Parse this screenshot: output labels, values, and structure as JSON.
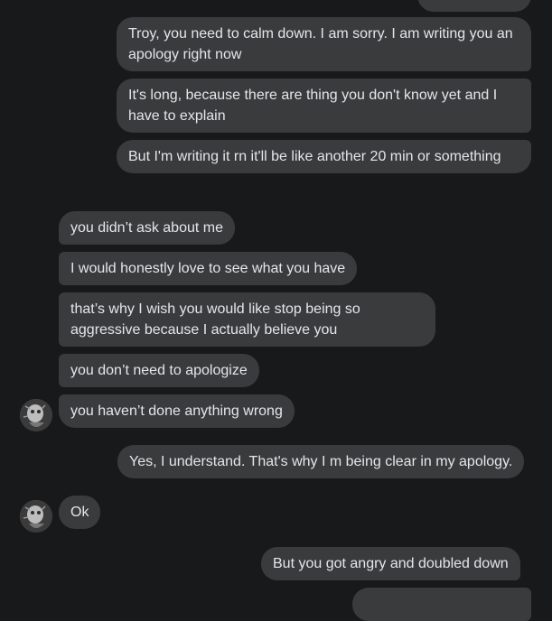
{
  "conversation": {
    "messages": [
      {
        "sender": "me",
        "text": "Troy, you need to calm down. I am sorry. I am writing you an apology right now"
      },
      {
        "sender": "me",
        "text": "It's long, because there are thing you don't know yet and I have to explain"
      },
      {
        "sender": "me",
        "text": "But I'm writing it rn it'll be like another 20 min or something"
      },
      {
        "sender": "them",
        "text": "you didn’t ask about me"
      },
      {
        "sender": "them",
        "text": "I would honestly love to see what you have"
      },
      {
        "sender": "them",
        "text": "that’s why I wish you would like stop being so aggressive because I actually believe you"
      },
      {
        "sender": "them",
        "text": "you don’t need to apologize"
      },
      {
        "sender": "them",
        "text": "you haven’t done anything wrong"
      },
      {
        "sender": "me",
        "text": "Yes, I understand. That's why I m being clear in my apology."
      },
      {
        "sender": "them",
        "text": "Ok"
      },
      {
        "sender": "me",
        "text": "But you got angry and doubled down"
      }
    ]
  },
  "colors": {
    "background": "#18191a",
    "bubble": "#3a3b3c",
    "text": "#e4e6eb"
  },
  "icons": {
    "avatar": "contact-avatar"
  }
}
